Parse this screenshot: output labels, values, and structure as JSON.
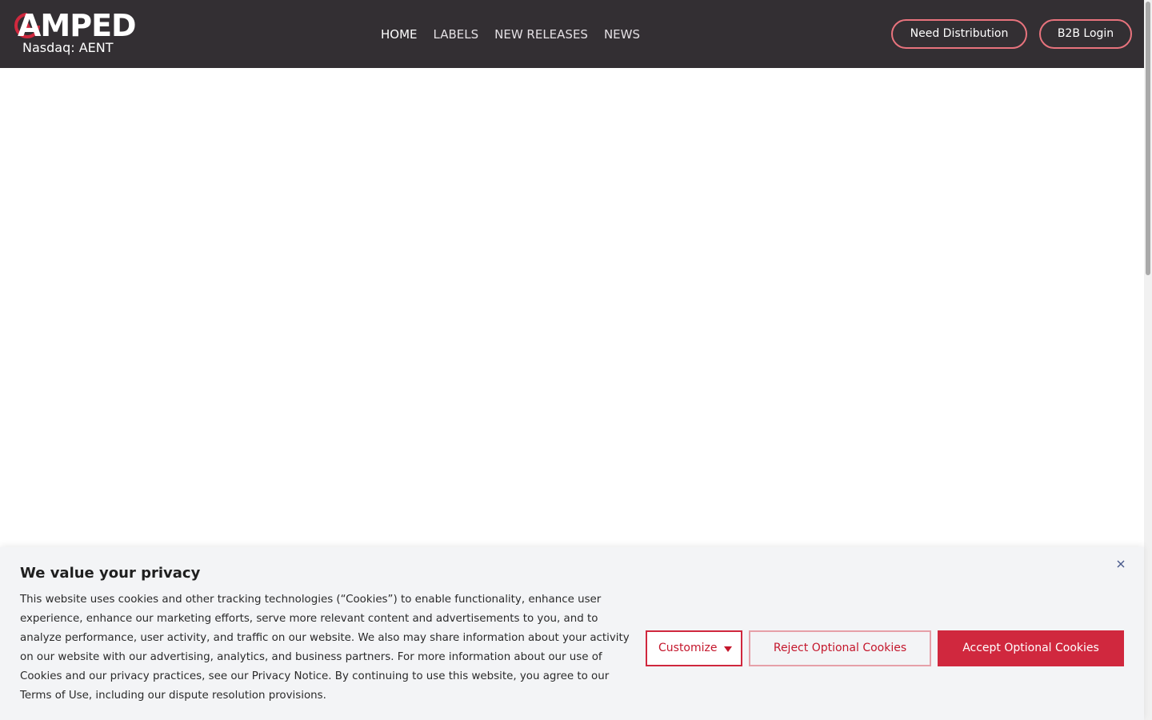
{
  "header": {
    "logo": {
      "wordmark": "AMPED",
      "subtitle": "Nasdaq: AENT"
    },
    "nav": [
      {
        "label": "HOME",
        "active": true
      },
      {
        "label": "LABELS",
        "active": false
      },
      {
        "label": "NEW RELEASES",
        "active": false
      },
      {
        "label": "NEWS",
        "active": false
      }
    ],
    "buttons": {
      "distribution": "Need Distribution",
      "b2b_login": "B2B Login"
    }
  },
  "cookie_banner": {
    "title": "We value your privacy",
    "body": "This website uses cookies and other tracking technologies (“Cookies”) to enable functionality, enhance user experience, enhance our marketing efforts, serve more relevant content and advertisements to you, and to analyze performance, user activity, and traffic on our website. We also may share information about your activity on our website with our advertising, analytics, and business partners. For more information about our use of Cookies and our privacy practices, see our Privacy Notice. By continuing to use this website, you agree to our Terms of Use, including our dispute resolution provisions.",
    "buttons": {
      "customize": "Customize",
      "reject": "Reject Optional Cookies",
      "accept": "Accept Optional Cookies"
    },
    "icons": {
      "close": "close-icon",
      "caret": "caret-down-icon"
    }
  },
  "colors": {
    "header_bg": "#332f33",
    "accent": "#d0283e",
    "pill_border": "#e8737d",
    "banner_bg": "#f3f4f6"
  }
}
